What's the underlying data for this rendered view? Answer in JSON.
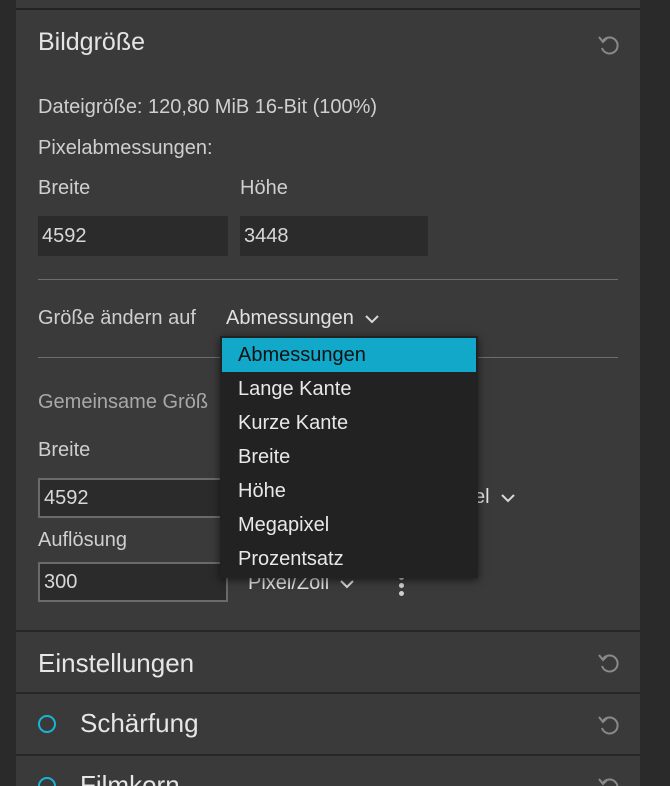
{
  "image_size": {
    "title": "Bildgröße",
    "file_size_text": "Dateigröße: 120,80 MiB 16-Bit (100%)",
    "pixel_dimensions_label": "Pixelabmessungen:",
    "width_label": "Breite",
    "height_label": "Höhe",
    "width_value": "4592",
    "height_value": "3448",
    "resize_to_label": "Größe ändern auf",
    "resize_mode_value": "Abmessungen",
    "common_size_label": "Gemeinsame Größ",
    "output_width_label": "Breite",
    "output_width_value": "4592",
    "unit_visible_fragment": "el",
    "resolution_label": "Auflösung",
    "resolution_value": "300",
    "resolution_unit": "Pixel/Zoll"
  },
  "resize_dropdown": {
    "options": [
      "Abmessungen",
      "Lange Kante",
      "Kurze Kante",
      "Breite",
      "Höhe",
      "Megapixel",
      "Prozentsatz"
    ],
    "selected_index": 0
  },
  "settings": {
    "title": "Einstellungen"
  },
  "sharpening": {
    "title": "Schärfung"
  },
  "film_grain": {
    "title": "Filmkorn"
  },
  "colors": {
    "accent": "#11a8c9",
    "ring": "#19b5d8",
    "panel": "#3a3a3a",
    "background": "#2a2a2a"
  },
  "icons": {
    "reset": "reset-icon",
    "chevron": "chevron-down-icon",
    "more": "more-vertical-icon"
  }
}
